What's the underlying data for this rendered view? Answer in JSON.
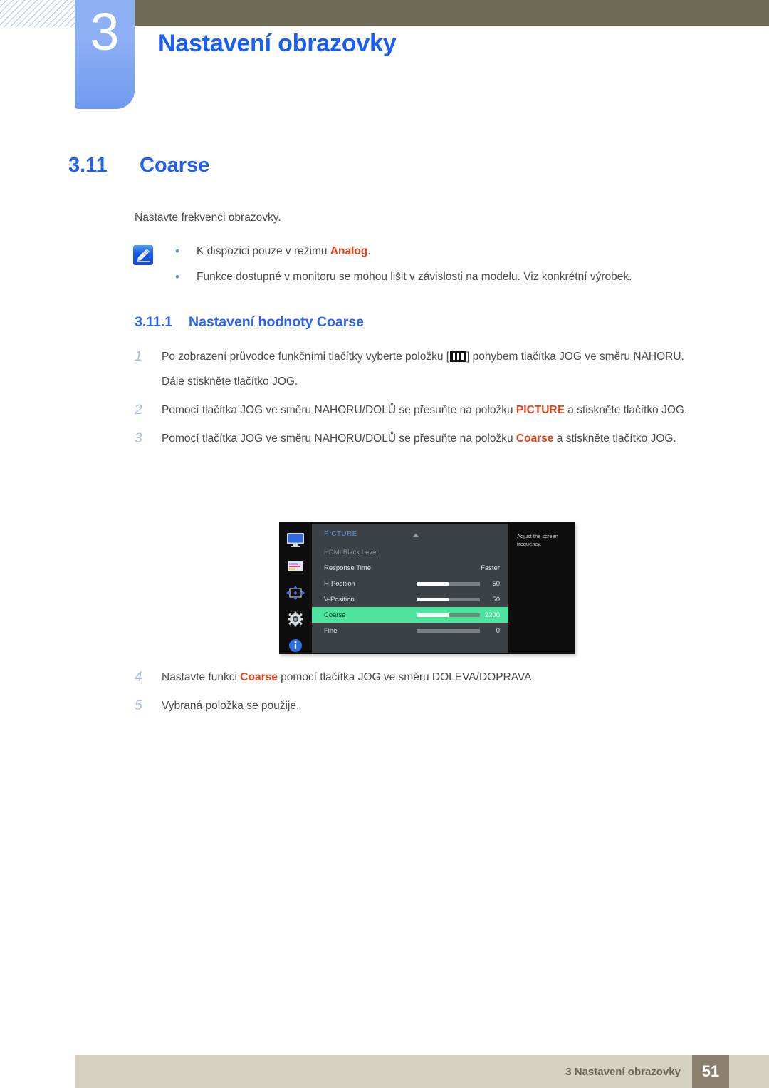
{
  "header": {
    "chapter_number": "3",
    "chapter_title": "Nastavení obrazovky"
  },
  "section": {
    "number": "3.11",
    "title": "Coarse",
    "intro": "Nastavte frekvenci obrazovky."
  },
  "note": {
    "icon": "note-pen-icon",
    "items": [
      {
        "prefix": "K dispozici pouze v režimu ",
        "keyword": "Analog",
        "suffix": "."
      },
      {
        "prefix": "Funkce dostupné v monitoru se mohou lišit v závislosti na modelu. Viz konkrétní výrobek.",
        "keyword": "",
        "suffix": ""
      }
    ]
  },
  "subsection": {
    "number": "3.11.1",
    "title": "Nastavení hodnoty Coarse"
  },
  "steps": [
    {
      "num": "1",
      "part1": "Po zobrazení průvodce funkčními tlačítky vyberte položku [",
      "part2": "] pohybem tlačítka JOG ve směru NAHORU.",
      "sub": "Dále stiskněte tlačítko JOG."
    },
    {
      "num": "2",
      "part1": "Pomocí tlačítka JOG ve směru NAHORU/DOLŮ se přesuňte na položku ",
      "keyword": "PICTURE",
      "part2": " a stiskněte tlačítko JOG."
    },
    {
      "num": "3",
      "part1": "Pomocí tlačítka JOG ve směru NAHORU/DOLŮ se přesuňte na položku ",
      "keyword": "Coarse",
      "part2": " a stiskněte tlačítko JOG."
    },
    {
      "num": "4",
      "part1": "Nastavte funkci ",
      "keyword": "Coarse",
      "part2": " pomocí tlačítka JOG ve směru DOLEVA/DOPRAVA."
    },
    {
      "num": "5",
      "part1": "Vybraná položka se použije.",
      "keyword": "",
      "part2": ""
    }
  ],
  "osd": {
    "menu_title": "PICTURE",
    "tooltip": "Adjust the screen frequency.",
    "rail_icons": [
      "monitor-icon",
      "color-bars-icon",
      "position-arrows-icon",
      "gear-icon",
      "info-icon"
    ],
    "rows": [
      {
        "label": "HDMI Black Level",
        "value": "",
        "has_bar": false,
        "fill": 0,
        "state": "disabled"
      },
      {
        "label": "Response Time",
        "value": "Faster",
        "has_bar": false,
        "fill": 0,
        "state": "normal"
      },
      {
        "label": "H-Position",
        "value": "50",
        "has_bar": true,
        "fill": 50,
        "state": "normal"
      },
      {
        "label": "V-Position",
        "value": "50",
        "has_bar": true,
        "fill": 50,
        "state": "normal"
      },
      {
        "label": "Coarse",
        "value": "2200",
        "has_bar": true,
        "fill": 50,
        "state": "selected"
      },
      {
        "label": "Fine",
        "value": "0",
        "has_bar": true,
        "fill": 0,
        "state": "normal"
      }
    ]
  },
  "footer": {
    "text": "3 Nastavení obrazovky",
    "page": "51"
  },
  "colors": {
    "accent_blue": "#1a5ef5",
    "keyword_red": "#e2431a",
    "header_band": "#6e6a56",
    "footer_band": "#d6d2bf",
    "page_badge": "#8b7f6e",
    "osd_highlight": "#4ee49e"
  }
}
